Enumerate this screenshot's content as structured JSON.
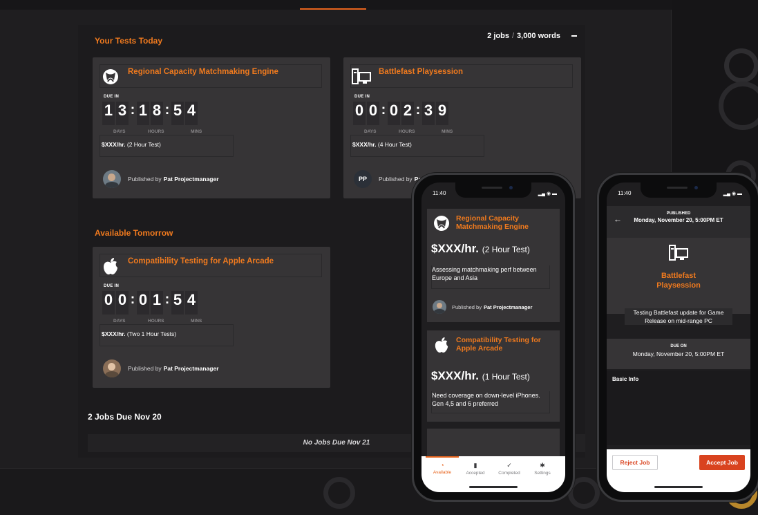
{
  "today": {
    "title": "Your Tests Today",
    "summary_jobs": "2 jobs",
    "summary_sep": "/",
    "summary_words": "3,000 words",
    "collapse_icon": "minus-icon"
  },
  "timer_labels": {
    "days": "DAYS",
    "hours": "HOURS",
    "mins": "MINS"
  },
  "due_in_label": "DUE IN",
  "published_by": "Published by",
  "cards": [
    {
      "title": "Regional Capacity Matchmaking Engine",
      "icon": "xbox-icon",
      "digits": [
        "1",
        "3",
        "1",
        "8",
        "5",
        "4"
      ],
      "rate": "$XXX/hr.",
      "rate_note": "(2 Hour Test)",
      "publisher": "Pat Projectmanager"
    },
    {
      "title": "Battlefast Playsession",
      "icon": "pc-icon",
      "digits": [
        "0",
        "0",
        "0",
        "2",
        "3",
        "9"
      ],
      "rate": "$XXX/hr.",
      "rate_note": "(4 Hour Test)",
      "publisher_initials": "PP",
      "publisher": "Pa"
    },
    {
      "title": "Compatibility Testing for Apple Arcade",
      "icon": "apple-icon",
      "digits": [
        "0",
        "0",
        "0",
        "1",
        "5",
        "4"
      ],
      "rate": "$XXX/hr.",
      "rate_note": "(Two 1 Hour Tests)",
      "publisher": "Pat Projectmanager"
    }
  ],
  "tomorrow": {
    "title": "Available Tomorrow"
  },
  "due_nov20": {
    "title": "2 Jobs Due Nov 20"
  },
  "no_jobs": "No Jobs Due Nov 21",
  "phone1": {
    "time": "11:40",
    "cards": [
      {
        "title": "Regional Capacity Matchmaking Engine",
        "rate": "$XXX/hr.",
        "rate_note": "(2 Hour Test)",
        "desc": "Assessing matchmaking perf between Europe and Asia",
        "publisher": "Pat Projectmanager"
      },
      {
        "title": "Compatibility Testing for Apple Arcade",
        "rate": "$XXX/hr.",
        "rate_note": "(1 Hour Test)",
        "desc": "Need coverage on down-level iPhones. Gen 4,5 and 6 preferred"
      }
    ],
    "tabs": [
      {
        "label": "Available",
        "icon": "available-icon"
      },
      {
        "label": "Accepted",
        "icon": "trash-icon"
      },
      {
        "label": "Completed",
        "icon": "check-icon"
      },
      {
        "label": "Settings",
        "icon": "gear-icon"
      }
    ]
  },
  "phone2": {
    "time": "11:40",
    "published_label": "PUBLISHED",
    "published_date": "Monday, November 20, 5:00PM ET",
    "title": "Battlefast Playsession",
    "desc": "Testing Battlefast update for Game Release on mid-range PC",
    "due_on_label": "DUE ON",
    "due_on_date": "Monday, November 20, 5:00PM ET",
    "basic_info": "Basic Info",
    "reject": "Reject Job",
    "accept": "Accept Job"
  },
  "colors": {
    "accent": "#f07a1e",
    "reject": "#d9431f"
  }
}
